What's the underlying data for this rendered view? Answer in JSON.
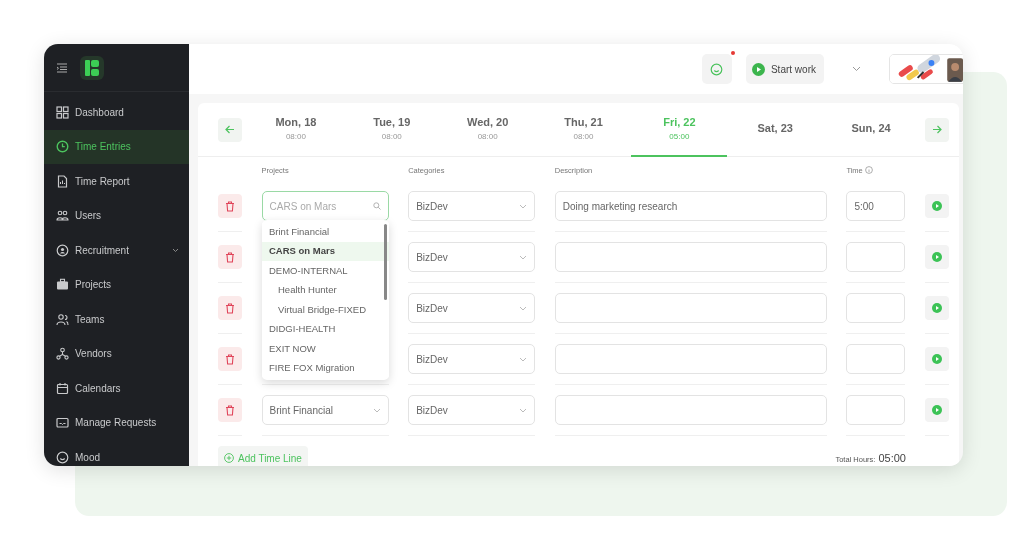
{
  "sidebar": {
    "items": [
      {
        "label": "Dashboard",
        "selected": false,
        "has_submenu": false
      },
      {
        "label": "Time Entries",
        "selected": true,
        "has_submenu": false
      },
      {
        "label": "Time Report",
        "selected": false,
        "has_submenu": false
      },
      {
        "label": "Users",
        "selected": false,
        "has_submenu": false
      },
      {
        "label": "Recruitment",
        "selected": false,
        "has_submenu": true
      },
      {
        "label": "Projects",
        "selected": false,
        "has_submenu": false
      },
      {
        "label": "Teams",
        "selected": false,
        "has_submenu": false
      },
      {
        "label": "Vendors",
        "selected": false,
        "has_submenu": false
      },
      {
        "label": "Calendars",
        "selected": false,
        "has_submenu": false
      },
      {
        "label": "Manage Requests",
        "selected": false,
        "has_submenu": false
      },
      {
        "label": "Mood",
        "selected": false,
        "has_submenu": false
      }
    ]
  },
  "header": {
    "notification": true,
    "start_button": "Start work"
  },
  "week": {
    "days": [
      {
        "label": "Mon, 18",
        "hours": "08:00",
        "selected": false
      },
      {
        "label": "Tue, 19",
        "hours": "08:00",
        "selected": false
      },
      {
        "label": "Wed, 20",
        "hours": "08:00",
        "selected": false
      },
      {
        "label": "Thu, 21",
        "hours": "08:00",
        "selected": false
      },
      {
        "label": "Fri, 22",
        "hours": "05:00",
        "selected": true
      },
      {
        "label": "Sat, 23",
        "selected": false
      },
      {
        "label": "Sun, 24",
        "selected": false
      }
    ]
  },
  "columns": [
    "Projects",
    "Categories",
    "Description",
    "Time"
  ],
  "rows": [
    {
      "project_placeholder": "CARS on Mars",
      "focused": true,
      "category": "BizDev",
      "description": "Doing marketing research",
      "time": "5:00",
      "dropdown": {
        "options": [
          {
            "label": "Brint Financial",
            "selected": false
          },
          {
            "label": "CARS on Mars",
            "selected": true
          },
          {
            "label": "DEMO-INTERNAL",
            "selected": false,
            "children": [
              {
                "label": "Health Hunter",
                "selected": false
              },
              {
                "label": "Virtual Bridge-FIXED",
                "selected": false
              }
            ]
          },
          {
            "label": "DIDGI-HEALTH",
            "selected": false
          },
          {
            "label": "EXIT NOW",
            "selected": false
          },
          {
            "label": "FIRE FOX Migration",
            "selected": false
          }
        ]
      }
    },
    {
      "category": "BizDev"
    },
    {
      "category": "BizDev"
    },
    {
      "category": "BizDev"
    },
    {
      "project": "Brint Financial",
      "focused": false,
      "category": "BizDev"
    }
  ],
  "add_button": "Add Time Line",
  "total_label": "Total Hours:",
  "total_value": "05:00"
}
